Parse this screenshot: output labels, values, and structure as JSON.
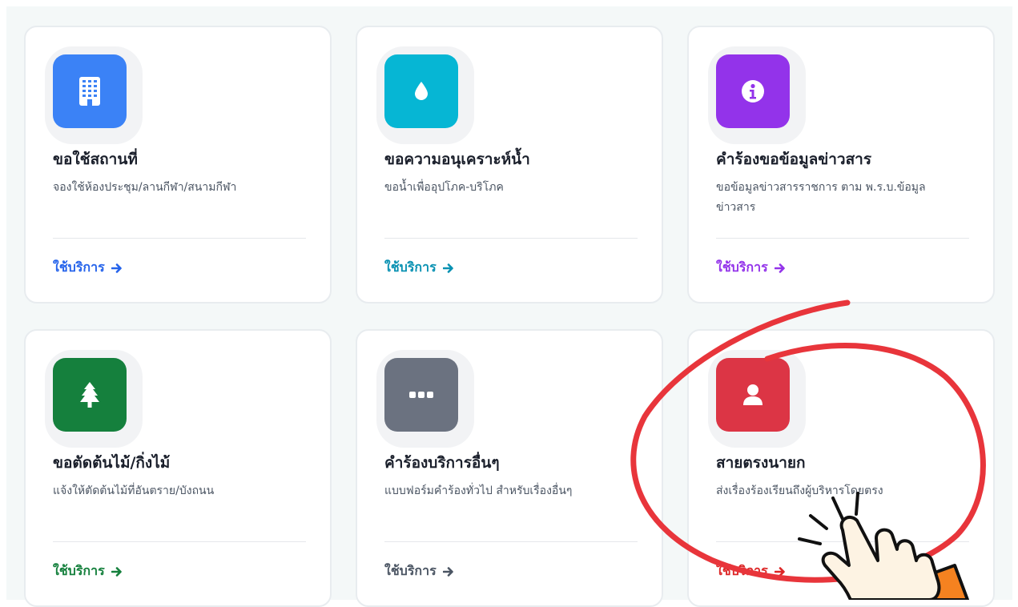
{
  "cards": [
    {
      "title": "ขอใช้สถานที่",
      "description": "จองใช้ห้องประชุม/ลานกีฬา/สนามกีฬา",
      "link_label": "ใช้บริการ",
      "icon": "building-icon",
      "icon_color": "#3b82f6",
      "link_color": "#2563eb"
    },
    {
      "title": "ขอความอนุเคราะห์น้ำ",
      "description": "ขอน้ำเพื่ออุปโภค-บริโภค",
      "link_label": "ใช้บริการ",
      "icon": "water-drop-icon",
      "icon_color": "#06b6d4",
      "link_color": "#0891b2"
    },
    {
      "title": "คำร้องขอข้อมูลข่าวสาร",
      "description": "ขอข้อมูลข่าวสารราชการ ตาม พ.ร.บ.ข้อมูลข่าวสาร",
      "link_label": "ใช้บริการ",
      "icon": "info-icon",
      "icon_color": "#9333ea",
      "link_color": "#9333ea"
    },
    {
      "title": "ขอตัดต้นไม้/กิ่งไม้",
      "description": "แจ้งให้ตัดต้นไม้ที่อันตราย/บังถนน",
      "link_label": "ใช้บริการ",
      "icon": "tree-icon",
      "icon_color": "#15803d",
      "link_color": "#15803d"
    },
    {
      "title": "คำร้องบริการอื่นๆ",
      "description": "แบบฟอร์มคำร้องทั่วไป สำหรับเรื่องอื่นๆ",
      "link_label": "ใช้บริการ",
      "icon": "ellipsis-icon",
      "icon_color": "#6b7280",
      "link_color": "#4b5563"
    },
    {
      "title": "สายตรงนายก",
      "description": "ส่งเรื่องร้องเรียนถึงผู้บริหารโดยตรง",
      "link_label": "ใช้บริการ",
      "icon": "user-icon",
      "icon_color": "#dc3545",
      "link_color": "#dc2626"
    }
  ],
  "annotation": {
    "highlight_color": "#e8353b",
    "pointer_icon": "hand-pointer-icon",
    "sleeve_color": "#f58220",
    "hand_color": "#fdf3e3"
  }
}
